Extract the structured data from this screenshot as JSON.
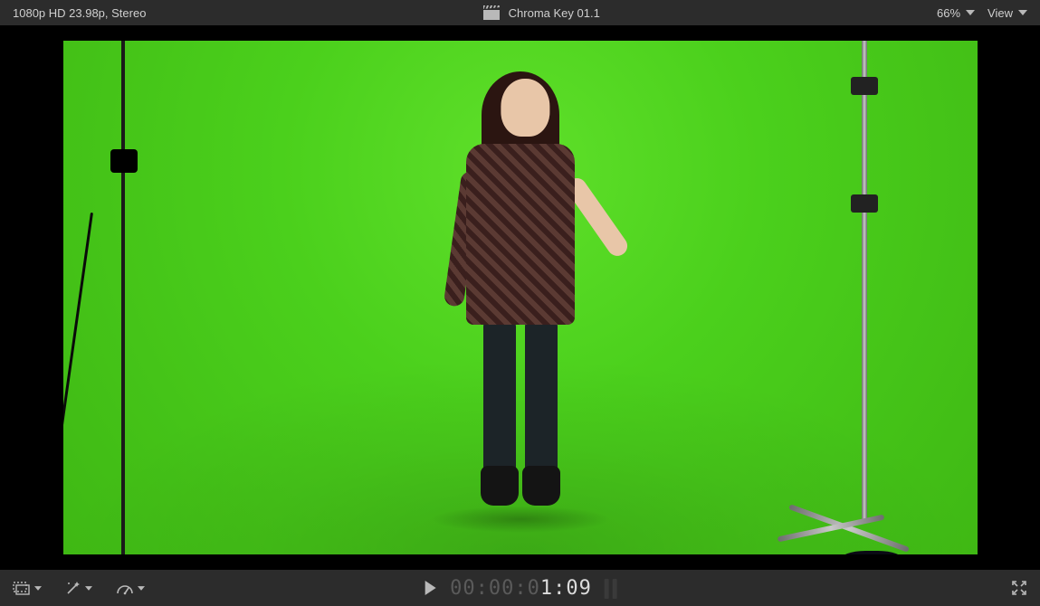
{
  "topbar": {
    "format_label": "1080p HD 23.98p, Stereo",
    "project_title": "Chroma Key 01.1",
    "zoom_label": "66%",
    "view_label": "View"
  },
  "transport": {
    "timecode_dim": "00:00:0",
    "timecode_bright": "1:09"
  },
  "icons": {
    "clapperboard": "clapperboard-icon",
    "chevron_down": "chevron-down-icon",
    "transform": "transform-crop-icon",
    "enhance": "magic-wand-icon",
    "retime": "speedometer-icon",
    "play": "play-icon",
    "fullscreen": "fullscreen-icon"
  }
}
